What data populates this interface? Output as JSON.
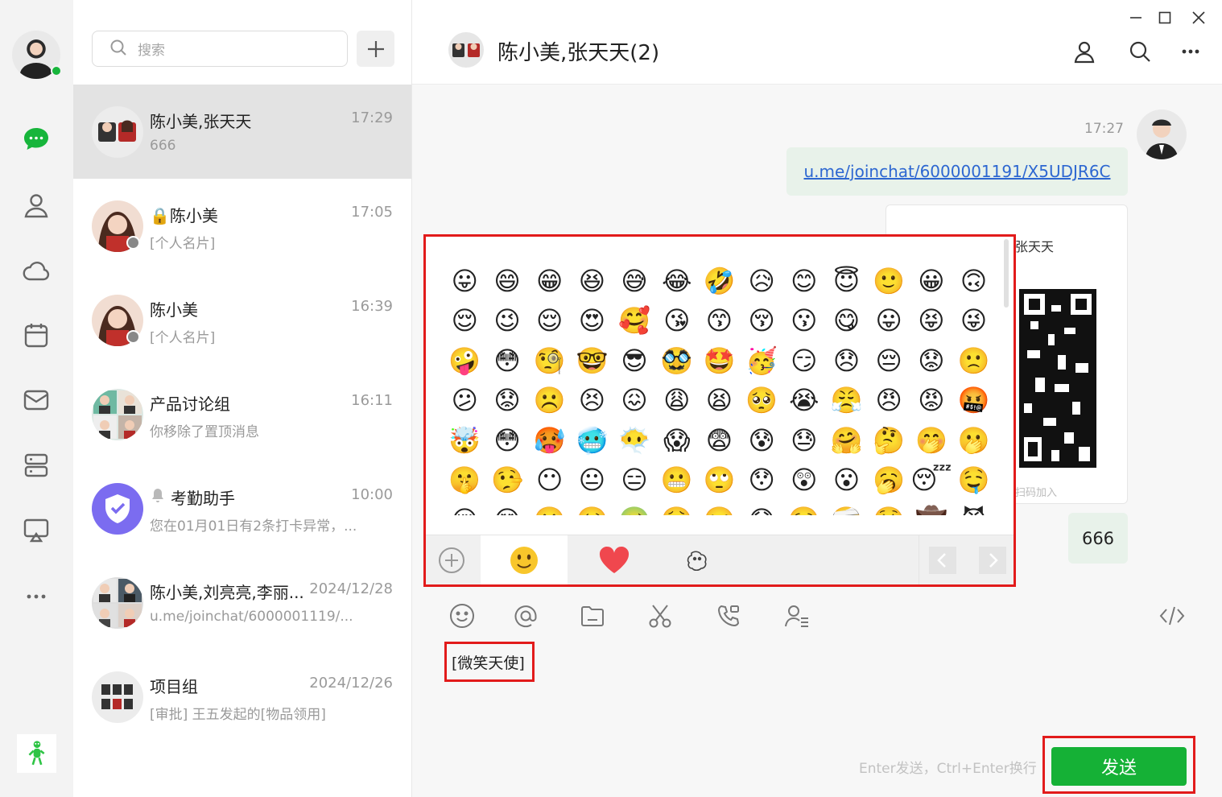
{
  "sidebar": {
    "icons": [
      "chat-bubble-icon",
      "contacts-icon",
      "cloud-icon",
      "calendar-icon",
      "mail-icon",
      "workbench-icon",
      "screen-share-icon",
      "more-icon"
    ]
  },
  "search": {
    "placeholder": "搜索"
  },
  "conversations": [
    {
      "name": "陈小美,张天天",
      "time": "17:29",
      "preview": "666"
    },
    {
      "name": "🔒陈小美",
      "time": "17:05",
      "preview": "[个人名片]"
    },
    {
      "name": "陈小美",
      "time": "16:39",
      "preview": "[个人名片]"
    },
    {
      "name": "产品讨论组",
      "time": "16:11",
      "preview": "你移除了置顶消息"
    },
    {
      "name": "考勤助手",
      "time": "10:00",
      "preview": "您在01月01日有2条打卡异常，..."
    },
    {
      "name": "陈小美,刘亮亮,李丽...",
      "time": "2024/12/28",
      "preview": "u.me/joinchat/6000001119/..."
    },
    {
      "name": "项目组",
      "time": "2024/12/26",
      "preview": "[审批] 王五发起的[物品领用]"
    }
  ],
  "chat": {
    "title": "陈小美,张天天(2)",
    "messages": {
      "time": "17:27",
      "link": "u.me/joinchat/6000001191/X5UDJR6C",
      "card_name": "张天天",
      "card_hint": "扫码加入",
      "text": "666"
    }
  },
  "emoji_panel": {
    "emojis": [
      "😛",
      "😄",
      "😁",
      "😆",
      "😅",
      "😂",
      "🤣",
      "😥",
      "😊",
      "😇",
      "🙂",
      "😀",
      "🙃",
      "😌",
      "😉",
      "😌",
      "😍",
      "🥰",
      "😘",
      "😙",
      "😚",
      "😗",
      "😋",
      "😛",
      "😝",
      "😜",
      "🤪",
      "😳",
      "🧐",
      "🤓",
      "😎",
      "🥸",
      "🤩",
      "🥳",
      "😏",
      "😞",
      "😔",
      "😟",
      "🙁",
      "😕",
      "😟",
      "☹️",
      "😣",
      "😖",
      "😩",
      "😫",
      "🥺",
      "😭",
      "😤",
      "😠",
      "😡",
      "🤬",
      "🤯",
      "😳",
      "🥵",
      "🥶",
      "😶‍🌫️",
      "😱",
      "😨",
      "😰",
      "😓",
      "🤗",
      "🤔",
      "🤭",
      "🫢",
      "🤫",
      "🤥",
      "😶",
      "😐",
      "😑",
      "😬",
      "🙄",
      "😯",
      "😲",
      "😮",
      "🥱",
      "😴",
      "🤤",
      "😪",
      "😵",
      "🤐",
      "🥴",
      "🤢",
      "🤮",
      "🤧",
      "😷",
      "🤒",
      "🤕",
      "🤑",
      "🤠",
      "😈"
    ],
    "tabs": [
      "add-emoji-icon",
      "smiley-tab-icon",
      "heart-tab-icon",
      "sticker-tab-icon"
    ]
  },
  "input": {
    "text": "[微笑天使]"
  },
  "footer": {
    "hint": "Enter发送，Ctrl+Enter换行",
    "send_label": "发送"
  }
}
